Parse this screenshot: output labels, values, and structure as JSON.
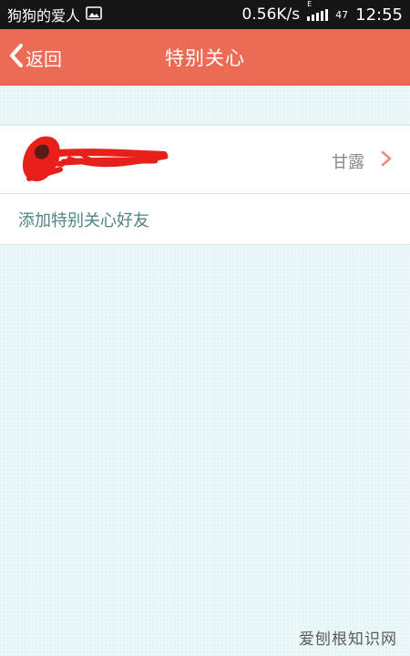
{
  "status_bar": {
    "notification_text": "狗狗的爱人",
    "net_speed": "0.56K/s",
    "network_type": "E",
    "battery": "47",
    "time": "12:55"
  },
  "title_bar": {
    "back_label": "返回",
    "title": "特别关心",
    "background_color": "#ec6b55"
  },
  "friend": {
    "name": "甘露"
  },
  "add_row": {
    "label": "添加特别关心好友"
  },
  "watermark": "爱刨根知识网"
}
